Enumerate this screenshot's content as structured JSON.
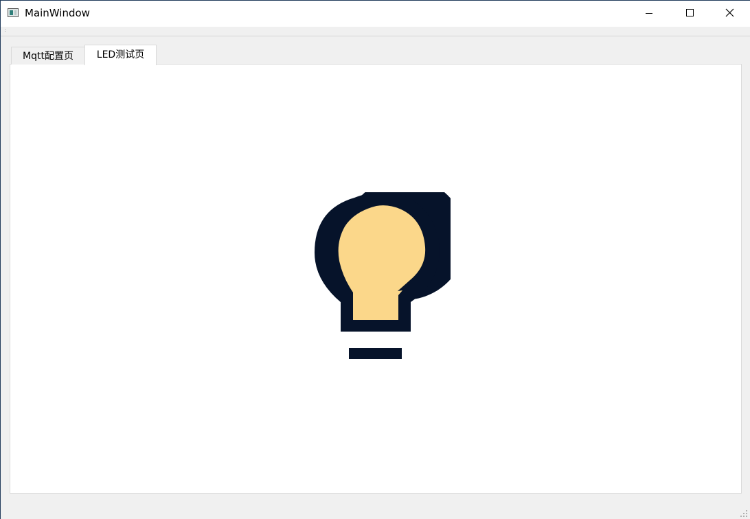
{
  "window": {
    "title": "MainWindow",
    "app_icon": "app-window-icon",
    "controls": {
      "minimize_icon": "minimize-icon",
      "maximize_icon": "maximize-icon",
      "close_icon": "close-icon"
    }
  },
  "tabs": [
    {
      "label": "Mqtt配置页",
      "selected": false
    },
    {
      "label": "LED测试页",
      "selected": true
    }
  ],
  "led_page": {
    "led_icon": "lightbulb-icon",
    "led_state": "on",
    "colors": {
      "bulb_fill": "#fbd78a",
      "bulb_outline": "#06132a"
    }
  }
}
